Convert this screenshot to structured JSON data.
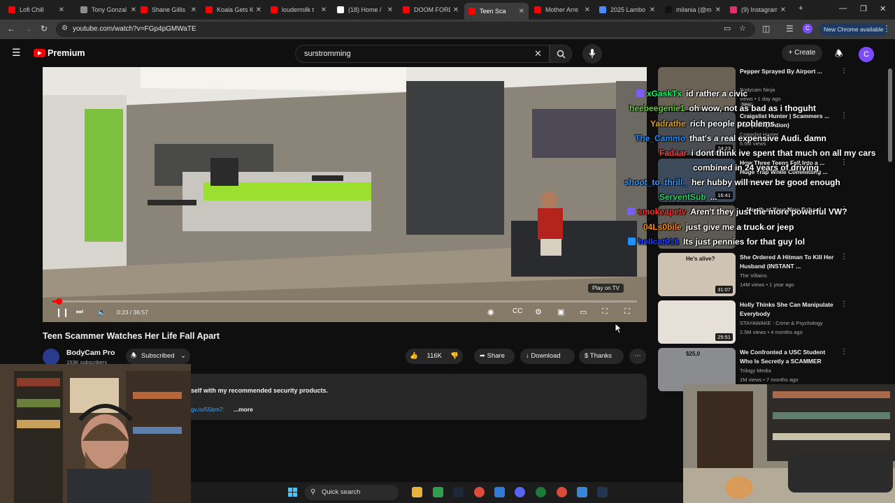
{
  "browser": {
    "tabs": [
      {
        "title": "Lofi Chill",
        "color": "#ff0000"
      },
      {
        "title": "Tony Gonzal",
        "color": "#8c8c8c"
      },
      {
        "title": "Shane Gillis",
        "color": "#ff0000"
      },
      {
        "title": "Koala Gets K",
        "color": "#ff0000"
      },
      {
        "title": "loudermilk t",
        "color": "#ff0000"
      },
      {
        "title": "(18) Home /",
        "color": "#ffffff"
      },
      {
        "title": "DOOM FORE",
        "color": "#ff0000"
      },
      {
        "title": "Teen Sca",
        "color": "#ff0000"
      },
      {
        "title": "Mother Arre",
        "color": "#ff0000"
      },
      {
        "title": "2025 Lambo",
        "color": "#4a8cff"
      },
      {
        "title": "milania (@m",
        "color": "#111111"
      },
      {
        "title": "(9) Instagram",
        "color": "#e1306c"
      }
    ],
    "url": "youtube.com/watch?v=FGp4pGMWaTE",
    "profile_initial": "C",
    "new_chrome_label": "New Chrome available"
  },
  "youtube": {
    "logo_text": "Premium",
    "search_value": "surstromming",
    "create_label": "Create",
    "avatar_initial": "C"
  },
  "player": {
    "time": "0:23 / 36:57",
    "progress": 0.0104,
    "play_on_tv": "Play on TV"
  },
  "video": {
    "title": "Teen Scammer Watches Her Life Fall Apart",
    "channel": "BodyCam Pro",
    "subscribers": "153K subscribers",
    "subscribed_label": "Subscribed",
    "likes": "116K",
    "share_label": "Share",
    "download_label": "Download",
    "thanks_label": "Thanks",
    "description_line": "self with my recommended security products.",
    "description_link": "gv.io/55bm7:",
    "more_label": "...more"
  },
  "recommendations": [
    {
      "title": "Pepper Sprayed By Airport ...",
      "channel": "Bodycam Ninja",
      "meta": "views • 1 day ago",
      "duration": "",
      "badge": "New"
    },
    {
      "title": "Craigslist Hunter | Scammers ... Act (Compilation)",
      "channel": "Craigslist Hunter",
      "meta": "6.9M views",
      "duration": "24:23",
      "badge": ""
    },
    {
      "title": "How Three Teens Fell Into a ... Huge Trap While Committing ...",
      "channel": "",
      "meta": "4.4M views • 1 year ago",
      "duration": "16:41",
      "badge": ""
    },
    {
      "title": "... Month at Your New School",
      "channel": "",
      "meta": "2.6M views",
      "duration": "",
      "badge": ""
    },
    {
      "title": "She Ordered A Hitman To Kill Her Husband (INSTANT ...",
      "channel": "The Villains",
      "meta": "14M views • 1 year ago",
      "duration": "31:07",
      "badge": "",
      "thumb_text": "He's alive?"
    },
    {
      "title": "Holly Thinks She Can Manipulate Everybody",
      "channel": "STAYAWAKE - Crime & Psychology",
      "meta": "2.5M views • 4 months ago",
      "duration": "25:51",
      "badge": ""
    },
    {
      "title": "We Confronted a USC Student Who Is Secretly a SCAMMER",
      "channel": "Trilogy Media",
      "meta": "1M views • 7 months ago",
      "duration": "",
      "badge": "",
      "thumb_text": "$25,0"
    }
  ],
  "chat": [
    {
      "user": "xGaskTx",
      "msg": "id rather a civic",
      "color": "#00ff66",
      "badge": "#7b5cff"
    },
    {
      "user": "heebeegenie1",
      "msg": "oh wow, not as bad as i thoguht",
      "color": "#66cc33",
      "badge": ""
    },
    {
      "user": "Yadrathe",
      "msg": "rich people problems",
      "color": "#daa520",
      "badge": ""
    },
    {
      "user": "The_Cammo",
      "msg": "that's a real expensive Audi. damn",
      "color": "#1e90ff",
      "badge": ""
    },
    {
      "user": "Fadaar",
      "msg": "i dont think ive spent that much on all my cars",
      "color": "#ff4040",
      "badge": ""
    },
    {
      "user": "",
      "msg": "combined in 24 years of driving",
      "color": "#ffffff",
      "badge": ""
    },
    {
      "user": "shoot_to_thrill_",
      "msg": "her hubby will never be good enough",
      "color": "#3399ff",
      "badge": ""
    },
    {
      "user": "ServentSub",
      "msg": "...",
      "color": "#33cc66",
      "badge": ""
    },
    {
      "user": "smokeapetv",
      "msg": "Aren't they just the more powerful VW?",
      "color": "#ff3030",
      "badge": "#7b5cff"
    },
    {
      "user": "04Ls0bile",
      "msg": "just give me a truck or jeep",
      "color": "#ff8c00",
      "badge": ""
    },
    {
      "user": "hellcat918",
      "msg": "Its just pennies for that guy lol",
      "color": "#1e40ff",
      "badge": "#2090ff"
    }
  ],
  "taskbar": {
    "quick_search": "Quick search"
  },
  "colors": {
    "accent_red": "#ff0000",
    "background": "#0f0f0f",
    "pill": "#272727"
  }
}
